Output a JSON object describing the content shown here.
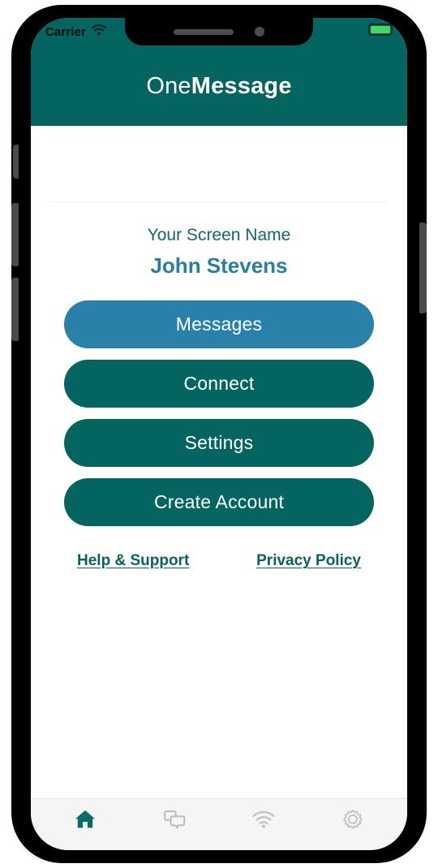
{
  "device": {
    "status_bar": {
      "carrier": "Carrier",
      "wifi_icon": "wifi-icon",
      "battery_icon": "battery-icon",
      "battery_color": "#44d863"
    },
    "notch": {
      "speaker_icon": "speaker-grille-icon",
      "camera_icon": "front-camera-icon"
    },
    "hardware_buttons": {
      "mute": "mute-switch",
      "volume_up": "volume-up-button",
      "volume_down": "volume-down-button",
      "power": "power-button"
    }
  },
  "header": {
    "title_part1": "One",
    "title_part2": "Message",
    "background": "#046460"
  },
  "main": {
    "screen_name_label": "Your Screen Name",
    "screen_name_value": "John Stevens",
    "buttons": [
      {
        "label": "Messages",
        "style": "primary",
        "color": "#2980a8"
      },
      {
        "label": "Connect",
        "style": "secondary",
        "color": "#046460"
      },
      {
        "label": "Settings",
        "style": "secondary",
        "color": "#046460"
      },
      {
        "label": "Create Account",
        "style": "secondary",
        "color": "#046460"
      }
    ],
    "links": [
      {
        "label": "Help & Support",
        "color": "#0c6159"
      },
      {
        "label": "Privacy Policy",
        "color": "#0c6159"
      }
    ]
  },
  "bottom_nav": {
    "active_color": "#0a6a68",
    "inactive_color": "#b3b3b3",
    "items": [
      {
        "icon": "home-icon",
        "active": true
      },
      {
        "icon": "chat-icon",
        "active": false
      },
      {
        "icon": "wifi-icon",
        "active": false
      },
      {
        "icon": "settings-gear-icon",
        "active": false
      }
    ]
  }
}
